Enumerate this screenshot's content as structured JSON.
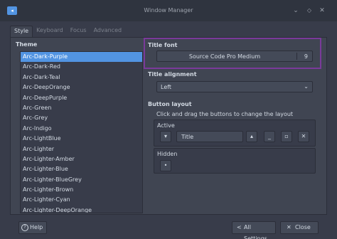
{
  "window": {
    "title": "Window Manager",
    "icon": "xfwm-app-icon",
    "controls": {
      "minimize": "⌄",
      "maximize": "◇",
      "close": "✕"
    }
  },
  "tabs": [
    {
      "label": "Style",
      "active": true
    },
    {
      "label": "Keyboard",
      "active": false
    },
    {
      "label": "Focus",
      "active": false
    },
    {
      "label": "Advanced",
      "active": false
    }
  ],
  "theme": {
    "heading": "Theme",
    "items": [
      "Arc-Dark-Purple",
      "Arc-Dark-Red",
      "Arc-Dark-Teal",
      "Arc-DeepOrange",
      "Arc-DeepPurple",
      "Arc-Green",
      "Arc-Grey",
      "Arc-Indigo",
      "Arc-LightBlue",
      "Arc-Lighter",
      "Arc-Lighter-Amber",
      "Arc-Lighter-Blue",
      "Arc-Lighter-BlueGrey",
      "Arc-Lighter-Brown",
      "Arc-Lighter-Cyan",
      "Arc-Lighter-DeepOrange"
    ],
    "selected": "Arc-Dark-Purple"
  },
  "title_font": {
    "heading": "Title font",
    "font_name": "Source Code Pro Medium",
    "font_size": "9"
  },
  "title_alignment": {
    "heading": "Title alignment",
    "value": "Left",
    "arrow": "⌄"
  },
  "button_layout": {
    "heading": "Button layout",
    "hint": "Click and drag the buttons to change the layout",
    "active": {
      "label": "Active",
      "menu_glyph": "▾",
      "title_label": "Title",
      "shade_glyph": "▴",
      "minimize_glyph": "_",
      "maximize_glyph": "▫",
      "close_glyph": "✕"
    },
    "hidden": {
      "label": "Hidden",
      "stick_glyph": "•"
    }
  },
  "footer": {
    "help_label": "Help",
    "help_glyph": "?",
    "all_settings_label": "All Settings",
    "all_settings_glyph": "<",
    "close_label": "Close",
    "close_glyph": "✕"
  },
  "colors": {
    "accent": "#5294e2",
    "highlight_box": "#7a3a9a",
    "window_bg": "#383c4a",
    "titlebar_bg": "#2f343f"
  }
}
